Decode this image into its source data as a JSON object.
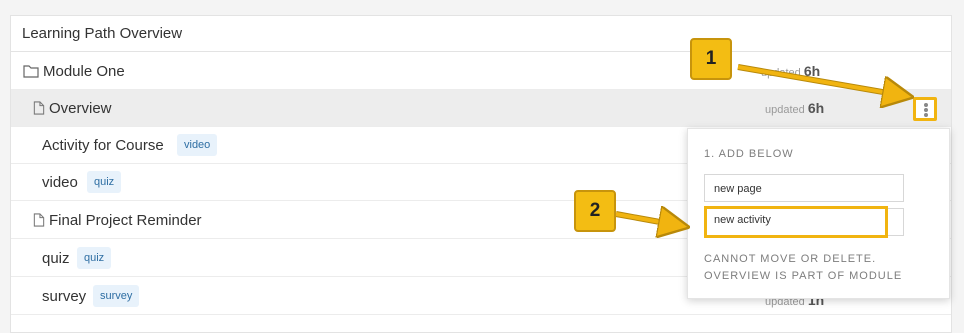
{
  "panel": {
    "title": "Learning Path Overview"
  },
  "rows": [
    {
      "title": "Module One",
      "icon": "folder-icon",
      "tag": "",
      "updated_prefix": "updated",
      "updated_value": "6h"
    },
    {
      "title": "Overview",
      "icon": "page-icon",
      "tag": "",
      "updated_prefix": "updated",
      "updated_value": "6h"
    },
    {
      "title": "Activity for Course",
      "icon": "",
      "tag": "video"
    },
    {
      "title": "video",
      "icon": "",
      "tag": "quiz"
    },
    {
      "title": "Final Project Reminder",
      "icon": "page-icon",
      "tag": ""
    },
    {
      "title": "quiz",
      "icon": "",
      "tag": "quiz"
    },
    {
      "title": "survey",
      "icon": "",
      "tag": "survey",
      "updated_prefix": "updated",
      "updated_value": "1h"
    }
  ],
  "dropdown": {
    "heading": "1. ADD BELOW",
    "options": [
      "new page",
      "new activity"
    ],
    "note": "CANNOT MOVE OR DELETE. OVERVIEW IS PART OF MODULE"
  },
  "callouts": [
    "1",
    "2"
  ],
  "colors": {
    "highlight": "#f1b410",
    "tag_bg": "#e8f2fb",
    "tag_text": "#2e6ea3",
    "selected_row": "#ededed"
  }
}
